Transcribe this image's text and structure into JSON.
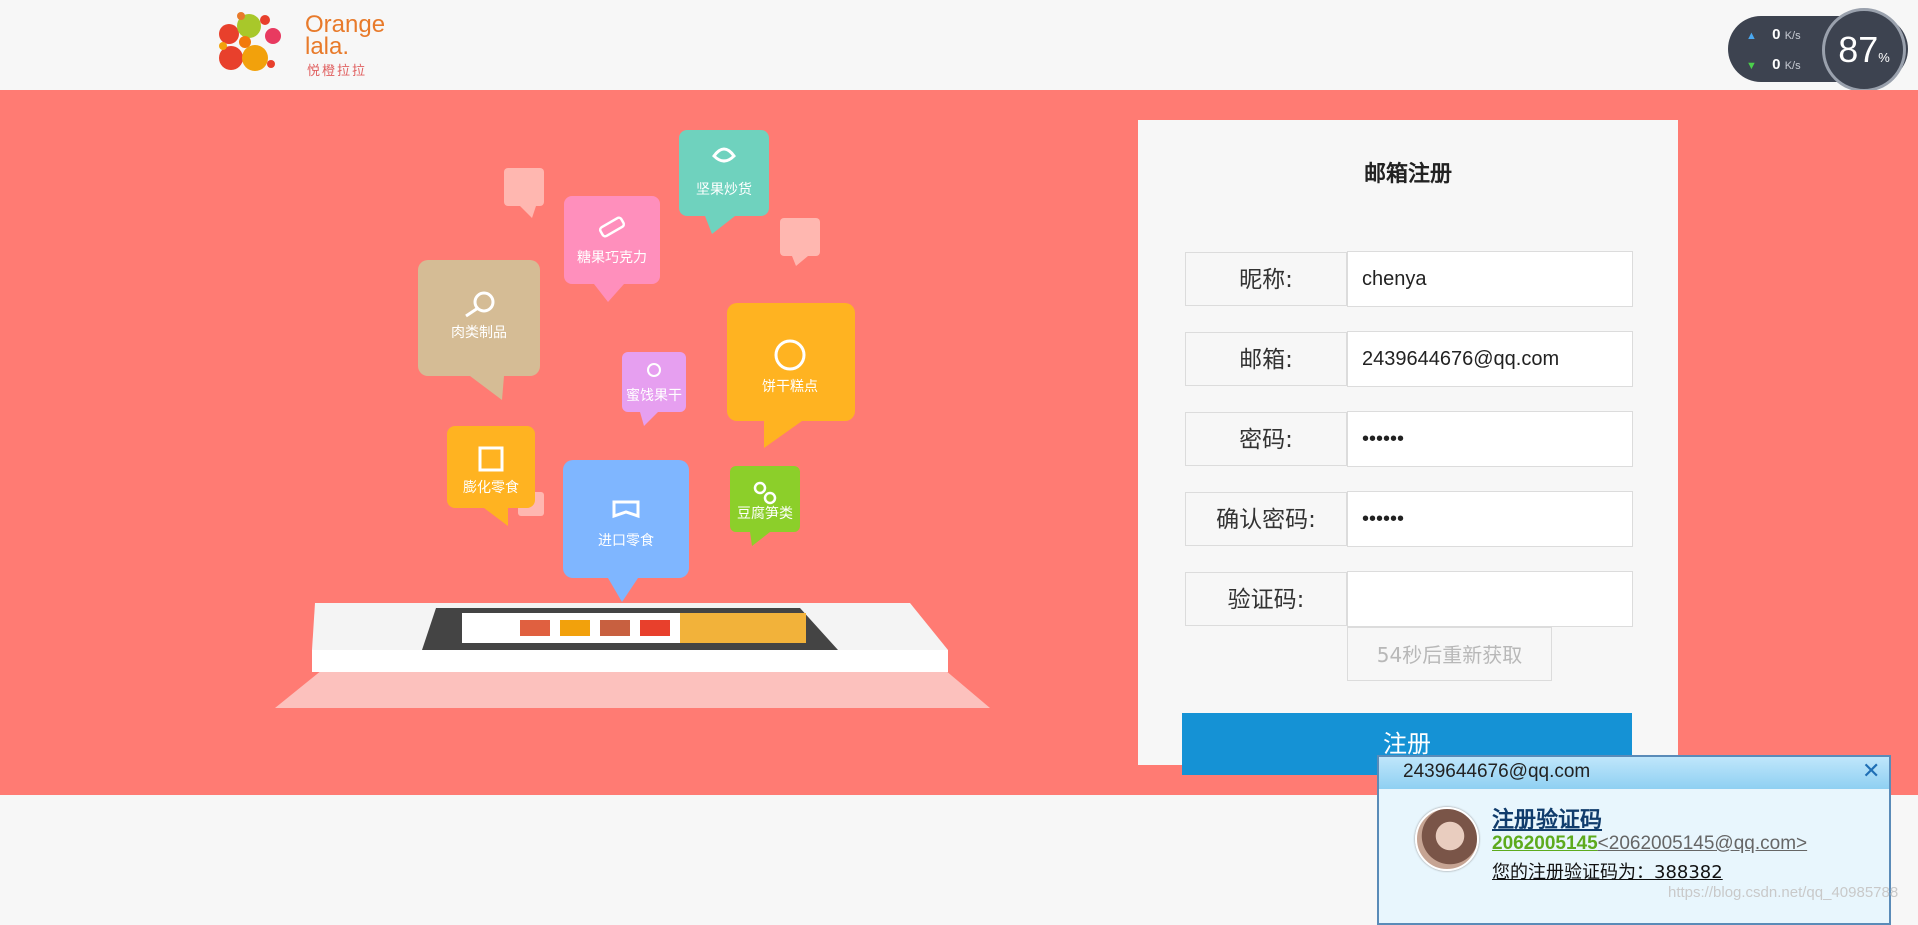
{
  "header": {
    "logo_text_line1": "Orange",
    "logo_text_line2": "lala.",
    "logo_sub": "悦橙拉拉"
  },
  "speed_widget": {
    "upload_value": "0",
    "upload_unit": "K/s",
    "download_value": "0",
    "download_unit": "K/s",
    "gauge_value": "87",
    "gauge_unit": "%"
  },
  "illustration": {
    "categories": [
      "坚果炒货",
      "糖果巧克力",
      "肉类制品",
      "饼干糕点",
      "蜜饯果干",
      "膨化零食",
      "进口零食",
      "豆腐笋类"
    ]
  },
  "form": {
    "title": "邮箱注册",
    "fields": [
      {
        "label": "昵称:",
        "value": "chenya"
      },
      {
        "label": "邮箱:",
        "value": "2439644676@qq.com"
      },
      {
        "label": "密码:",
        "value": "••••••"
      },
      {
        "label": "确认密码:",
        "value": "••••••"
      },
      {
        "label": "验证码:",
        "value": ""
      }
    ],
    "resend_button": "54秒后重新获取",
    "submit_button": "注册"
  },
  "notification": {
    "to": "2439644676@qq.com",
    "close_icon": "close-icon",
    "subject": "注册验证码",
    "sender_name": "2062005145",
    "sender_address": "<2062005145@qq.com>",
    "body": "您的注册验证码为：388382"
  },
  "watermark": "https://blog.csdn.net/qq_40985788",
  "colors": {
    "banner": "#ff7b73",
    "primary_button": "#1592d5",
    "background": "#f7f7f7"
  }
}
